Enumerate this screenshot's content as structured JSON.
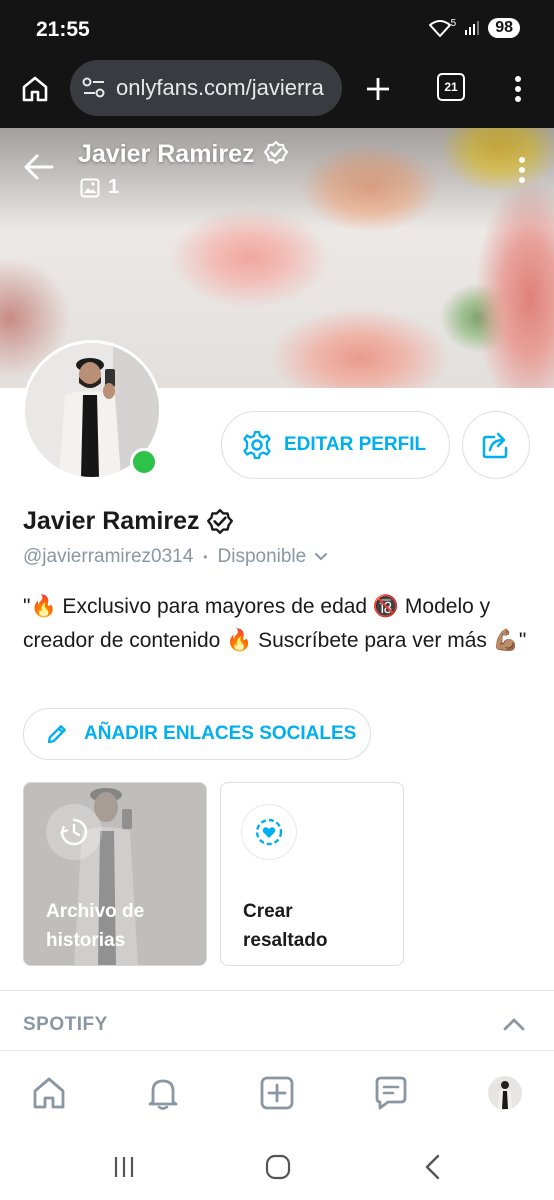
{
  "status_bar": {
    "time": "21:55",
    "battery": "98",
    "network": "5"
  },
  "browser": {
    "url": "onlyfans.com/javierra",
    "tab_count": "21"
  },
  "cover": {
    "title": "Javier Ramirez",
    "media_count": "1"
  },
  "profile": {
    "name": "Javier Ramirez",
    "handle": "@javierramirez0314",
    "separator": "•",
    "availability": "Disponible",
    "bio": "\"🔥 Exclusivo para mayores de edad 🔞 Modelo y creador de contenido 🔥 Suscríbete para ver más 💪🏽\"",
    "edit_button": "EDITAR PERFIL",
    "add_social_button": "AÑADIR ENLACES SOCIALES"
  },
  "highlights": {
    "archive_label_line1": "Archivo de",
    "archive_label_line2": "historias",
    "create_label_line1": "Crear",
    "create_label_line2": "resaltado"
  },
  "sections": {
    "spotify": "SPOTIFY"
  },
  "colors": {
    "accent": "#00aff0",
    "online": "#2ec24a",
    "muted": "#8a96a3"
  },
  "icons": {
    "home": "home-icon",
    "notifications": "bell-icon",
    "new_post": "plus-square-icon",
    "messages": "message-icon",
    "profile": "avatar"
  }
}
